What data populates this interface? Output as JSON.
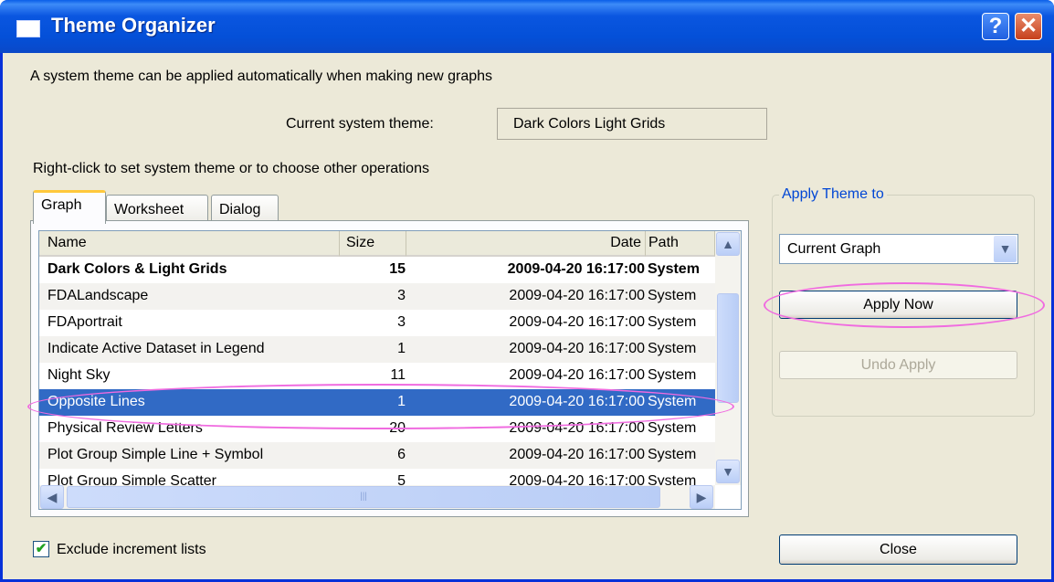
{
  "window": {
    "title": "Theme Organizer",
    "help_glyph": "?",
    "close_glyph": "✕"
  },
  "intro_text": "A system theme can be applied automatically when making new graphs",
  "current_theme": {
    "label": "Current system theme:",
    "value": "Dark Colors  Light Grids"
  },
  "instruction_text": "Right-click to set system theme or to choose other operations",
  "tabs": [
    {
      "label": "Graph",
      "active": true
    },
    {
      "label": "Worksheet",
      "active": false
    },
    {
      "label": "Dialog",
      "active": false
    }
  ],
  "theme_list": {
    "columns": {
      "name": "Name",
      "size": "Size",
      "date": "Date",
      "path": "Path"
    },
    "rows": [
      {
        "name": "Dark Colors & Light Grids",
        "size": "15",
        "date": "2009-04-20 16:17:00",
        "path": "System",
        "bold": true
      },
      {
        "name": "FDALandscape",
        "size": "3",
        "date": "2009-04-20 16:17:00",
        "path": "System"
      },
      {
        "name": "FDAportrait",
        "size": "3",
        "date": "2009-04-20 16:17:00",
        "path": "System"
      },
      {
        "name": "Indicate Active Dataset in Legend",
        "size": "1",
        "date": "2009-04-20 16:17:00",
        "path": "System"
      },
      {
        "name": "Night Sky",
        "size": "11",
        "date": "2009-04-20 16:17:00",
        "path": "System"
      },
      {
        "name": "Opposite Lines",
        "size": "1",
        "date": "2009-04-20 16:17:00",
        "path": "System",
        "selected": true
      },
      {
        "name": "Physical Review Letters",
        "size": "20",
        "date": "2009-04-20 16:17:00",
        "path": "System"
      },
      {
        "name": "Plot Group Simple Line + Symbol",
        "size": "6",
        "date": "2009-04-20 16:17:00",
        "path": "System"
      },
      {
        "name": "Plot Group Simple Scatter",
        "size": "5",
        "date": "2009-04-20 16:17:00",
        "path": "System"
      }
    ],
    "scroll_glyphs": {
      "up": "▲",
      "down": "▼",
      "left": "◀",
      "right": "▶",
      "grip": "|||"
    }
  },
  "apply_group": {
    "title": "Apply Theme to",
    "target_combo": "Current Graph",
    "combo_arrow": "▼",
    "apply_now_label": "Apply Now",
    "undo_apply_label": "Undo Apply"
  },
  "exclude_checkbox": {
    "label": "Exclude increment lists",
    "checked": true,
    "glyph": "✔"
  },
  "close_label": "Close",
  "colors": {
    "titlebar": "#0a56e0",
    "selection": "#316ac5",
    "highlight_ellipse": "#f06be0",
    "dialog_bg": "#ece9d8"
  }
}
